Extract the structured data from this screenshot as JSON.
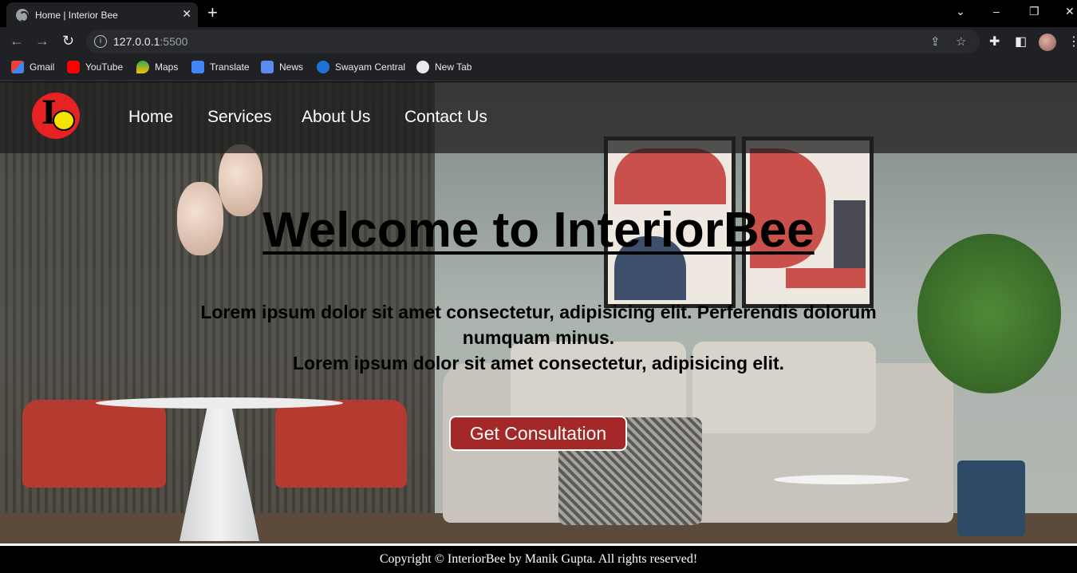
{
  "browser": {
    "tab_title": "Home | Interior Bee",
    "url_host": "127.0.0.1",
    "url_port": ":5500",
    "bookmarks": [
      {
        "label": "Gmail",
        "icon": "gmail-icon"
      },
      {
        "label": "YouTube",
        "icon": "youtube-icon"
      },
      {
        "label": "Maps",
        "icon": "maps-icon"
      },
      {
        "label": "Translate",
        "icon": "translate-icon"
      },
      {
        "label": "News",
        "icon": "news-icon"
      },
      {
        "label": "Swayam Central",
        "icon": "swayam-icon"
      },
      {
        "label": "New Tab",
        "icon": "globe-icon"
      }
    ]
  },
  "nav": {
    "links": [
      "Home",
      "Services",
      "About Us",
      "Contact Us"
    ]
  },
  "hero": {
    "title": "Welcome to InteriorBee",
    "line1": "Lorem ipsum dolor sit amet consectetur, adipisicing elit. Perferendis dolorum numquam minus.",
    "line2": "Lorem ipsum dolor sit amet consectetur, adipisicing elit.",
    "cta_label": "Get Consultation"
  },
  "footer": {
    "text": "Copyright © InteriorBee by Manik Gupta. All rights reserved!"
  },
  "colors": {
    "cta_bg": "#a52828",
    "logo_red": "#e62222",
    "logo_yellow": "#f5e400"
  }
}
